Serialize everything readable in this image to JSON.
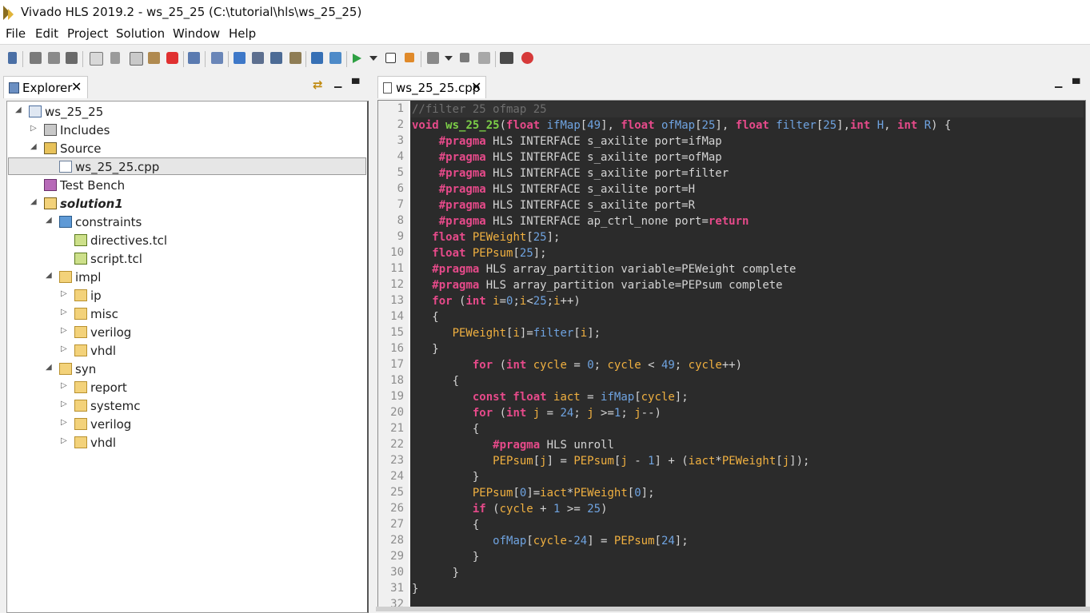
{
  "window": {
    "title": "Vivado HLS 2019.2 - ws_25_25 (C:\\tutorial\\hls\\ws_25_25)"
  },
  "menu": [
    "File",
    "Edit",
    "Project",
    "Solution",
    "Window",
    "Help"
  ],
  "explorer": {
    "tab_label": "Explorer",
    "tree": [
      {
        "label": "ws_25_25",
        "depth": 0,
        "twisty": "expanded",
        "icon": "project-icon"
      },
      {
        "label": "Includes",
        "depth": 1,
        "twisty": "collapsed",
        "icon": "includes-icon"
      },
      {
        "label": "Source",
        "depth": 1,
        "twisty": "expanded",
        "icon": "source-folder-icon"
      },
      {
        "label": "ws_25_25.cpp",
        "depth": 2,
        "twisty": "none",
        "icon": "cpp-file-icon",
        "selected": true
      },
      {
        "label": "Test Bench",
        "depth": 1,
        "twisty": "none",
        "icon": "testbench-icon"
      },
      {
        "label": "solution1",
        "depth": 1,
        "twisty": "expanded",
        "icon": "solution-folder-icon",
        "bold": true
      },
      {
        "label": "constraints",
        "depth": 2,
        "twisty": "expanded",
        "icon": "constraints-icon"
      },
      {
        "label": "directives.tcl",
        "depth": 3,
        "twisty": "none",
        "icon": "tcl-file-icon"
      },
      {
        "label": "script.tcl",
        "depth": 3,
        "twisty": "none",
        "icon": "tcl-file-icon"
      },
      {
        "label": "impl",
        "depth": 2,
        "twisty": "expanded",
        "icon": "folder-icon"
      },
      {
        "label": "ip",
        "depth": 3,
        "twisty": "collapsed",
        "icon": "folder-icon"
      },
      {
        "label": "misc",
        "depth": 3,
        "twisty": "collapsed",
        "icon": "folder-icon"
      },
      {
        "label": "verilog",
        "depth": 3,
        "twisty": "collapsed",
        "icon": "folder-icon"
      },
      {
        "label": "vhdl",
        "depth": 3,
        "twisty": "collapsed",
        "icon": "folder-icon"
      },
      {
        "label": "syn",
        "depth": 2,
        "twisty": "expanded",
        "icon": "folder-icon"
      },
      {
        "label": "report",
        "depth": 3,
        "twisty": "collapsed",
        "icon": "folder-icon"
      },
      {
        "label": "systemc",
        "depth": 3,
        "twisty": "collapsed",
        "icon": "folder-icon"
      },
      {
        "label": "verilog",
        "depth": 3,
        "twisty": "collapsed",
        "icon": "folder-icon"
      },
      {
        "label": "vhdl",
        "depth": 3,
        "twisty": "collapsed",
        "icon": "folder-icon"
      }
    ]
  },
  "editor": {
    "tab_label": "ws_25_25.cpp",
    "lines": [
      [
        [
          "cm",
          "//filter 25 ofmap 25"
        ]
      ],
      [
        [
          "kw",
          "void "
        ],
        [
          "fn",
          "ws_25_25"
        ],
        [
          "tx",
          "("
        ],
        [
          "kw",
          "float "
        ],
        [
          "par",
          "ifMap"
        ],
        [
          "tx",
          "["
        ],
        [
          "num",
          "49"
        ],
        [
          "tx",
          "], "
        ],
        [
          "kw",
          "float "
        ],
        [
          "par",
          "ofMap"
        ],
        [
          "tx",
          "["
        ],
        [
          "num",
          "25"
        ],
        [
          "tx",
          "], "
        ],
        [
          "kw",
          "float "
        ],
        [
          "par",
          "filter"
        ],
        [
          "tx",
          "["
        ],
        [
          "num",
          "25"
        ],
        [
          "tx",
          "],"
        ],
        [
          "kw",
          "int "
        ],
        [
          "par",
          "H"
        ],
        [
          "tx",
          ", "
        ],
        [
          "kw",
          "int "
        ],
        [
          "par",
          "R"
        ],
        [
          "tx",
          ") {"
        ]
      ],
      [
        [
          "tx",
          "    "
        ],
        [
          "pr",
          "#pragma"
        ],
        [
          "tx",
          " HLS INTERFACE s_axilite port=ifMap"
        ]
      ],
      [
        [
          "tx",
          "    "
        ],
        [
          "pr",
          "#pragma"
        ],
        [
          "tx",
          " HLS INTERFACE s_axilite port=ofMap"
        ]
      ],
      [
        [
          "tx",
          "    "
        ],
        [
          "pr",
          "#pragma"
        ],
        [
          "tx",
          " HLS INTERFACE s_axilite port=filter"
        ]
      ],
      [
        [
          "tx",
          "    "
        ],
        [
          "pr",
          "#pragma"
        ],
        [
          "tx",
          " HLS INTERFACE s_axilite port=H"
        ]
      ],
      [
        [
          "tx",
          "    "
        ],
        [
          "pr",
          "#pragma"
        ],
        [
          "tx",
          " HLS INTERFACE s_axilite port=R"
        ]
      ],
      [
        [
          "tx",
          "    "
        ],
        [
          "pr",
          "#pragma"
        ],
        [
          "tx",
          " HLS INTERFACE ap_ctrl_none port="
        ],
        [
          "kw",
          "return"
        ]
      ],
      [
        [
          "tx",
          "   "
        ],
        [
          "kw",
          "float "
        ],
        [
          "var",
          "PEWeight"
        ],
        [
          "tx",
          "["
        ],
        [
          "num",
          "25"
        ],
        [
          "tx",
          "];"
        ]
      ],
      [
        [
          "tx",
          "   "
        ],
        [
          "kw",
          "float "
        ],
        [
          "var",
          "PEPsum"
        ],
        [
          "tx",
          "["
        ],
        [
          "num",
          "25"
        ],
        [
          "tx",
          "];"
        ]
      ],
      [
        [
          "tx",
          "   "
        ],
        [
          "pr",
          "#pragma"
        ],
        [
          "tx",
          " HLS array_partition variable=PEWeight complete"
        ]
      ],
      [
        [
          "tx",
          "   "
        ],
        [
          "pr",
          "#pragma"
        ],
        [
          "tx",
          " HLS array_partition variable=PEPsum complete"
        ]
      ],
      [
        [
          "tx",
          "   "
        ],
        [
          "kw",
          "for "
        ],
        [
          "tx",
          "("
        ],
        [
          "kw",
          "int "
        ],
        [
          "var",
          "i"
        ],
        [
          "tx",
          "="
        ],
        [
          "num",
          "0"
        ],
        [
          "tx",
          ";"
        ],
        [
          "var",
          "i"
        ],
        [
          "tx",
          "<"
        ],
        [
          "num",
          "25"
        ],
        [
          "tx",
          ";"
        ],
        [
          "var",
          "i"
        ],
        [
          "tx",
          "++)"
        ]
      ],
      [
        [
          "tx",
          "   {"
        ]
      ],
      [
        [
          "tx",
          "      "
        ],
        [
          "var",
          "PEWeight"
        ],
        [
          "tx",
          "["
        ],
        [
          "var",
          "i"
        ],
        [
          "tx",
          "]="
        ],
        [
          "par",
          "filter"
        ],
        [
          "tx",
          "["
        ],
        [
          "var",
          "i"
        ],
        [
          "tx",
          "];"
        ]
      ],
      [
        [
          "tx",
          "   }"
        ]
      ],
      [
        [
          "tx",
          "         "
        ],
        [
          "kw",
          "for "
        ],
        [
          "tx",
          "("
        ],
        [
          "kw",
          "int "
        ],
        [
          "var",
          "cycle"
        ],
        [
          "tx",
          " = "
        ],
        [
          "num",
          "0"
        ],
        [
          "tx",
          "; "
        ],
        [
          "var",
          "cycle"
        ],
        [
          "tx",
          " < "
        ],
        [
          "num",
          "49"
        ],
        [
          "tx",
          "; "
        ],
        [
          "var",
          "cycle"
        ],
        [
          "tx",
          "++)"
        ]
      ],
      [
        [
          "tx",
          "      {"
        ]
      ],
      [
        [
          "tx",
          "         "
        ],
        [
          "kw",
          "const float "
        ],
        [
          "var",
          "iact"
        ],
        [
          "tx",
          " = "
        ],
        [
          "par",
          "ifMap"
        ],
        [
          "tx",
          "["
        ],
        [
          "var",
          "cycle"
        ],
        [
          "tx",
          "];"
        ]
      ],
      [
        [
          "tx",
          "         "
        ],
        [
          "kw",
          "for "
        ],
        [
          "tx",
          "("
        ],
        [
          "kw",
          "int "
        ],
        [
          "var",
          "j"
        ],
        [
          "tx",
          " = "
        ],
        [
          "num",
          "24"
        ],
        [
          "tx",
          "; "
        ],
        [
          "var",
          "j"
        ],
        [
          "tx",
          " >="
        ],
        [
          "num",
          "1"
        ],
        [
          "tx",
          "; "
        ],
        [
          "var",
          "j"
        ],
        [
          "tx",
          "--)"
        ]
      ],
      [
        [
          "tx",
          "         {"
        ]
      ],
      [
        [
          "tx",
          "            "
        ],
        [
          "pr",
          "#pragma"
        ],
        [
          "tx",
          " HLS unroll"
        ]
      ],
      [
        [
          "tx",
          "            "
        ],
        [
          "var",
          "PEPsum"
        ],
        [
          "tx",
          "["
        ],
        [
          "var",
          "j"
        ],
        [
          "tx",
          "] = "
        ],
        [
          "var",
          "PEPsum"
        ],
        [
          "tx",
          "["
        ],
        [
          "var",
          "j"
        ],
        [
          "tx",
          " - "
        ],
        [
          "num",
          "1"
        ],
        [
          "tx",
          "] + ("
        ],
        [
          "var",
          "iact"
        ],
        [
          "tx",
          "*"
        ],
        [
          "var",
          "PEWeight"
        ],
        [
          "tx",
          "["
        ],
        [
          "var",
          "j"
        ],
        [
          "tx",
          "]);"
        ]
      ],
      [
        [
          "tx",
          "         }"
        ]
      ],
      [
        [
          "tx",
          "         "
        ],
        [
          "var",
          "PEPsum"
        ],
        [
          "tx",
          "["
        ],
        [
          "num",
          "0"
        ],
        [
          "tx",
          "]="
        ],
        [
          "var",
          "iact"
        ],
        [
          "tx",
          "*"
        ],
        [
          "var",
          "PEWeight"
        ],
        [
          "tx",
          "["
        ],
        [
          "num",
          "0"
        ],
        [
          "tx",
          "];"
        ]
      ],
      [
        [
          "tx",
          "         "
        ],
        [
          "kw",
          "if "
        ],
        [
          "tx",
          "("
        ],
        [
          "var",
          "cycle"
        ],
        [
          "tx",
          " + "
        ],
        [
          "num",
          "1"
        ],
        [
          "tx",
          " >= "
        ],
        [
          "num",
          "25"
        ],
        [
          "tx",
          ")"
        ]
      ],
      [
        [
          "tx",
          "         {"
        ]
      ],
      [
        [
          "tx",
          "            "
        ],
        [
          "par",
          "ofMap"
        ],
        [
          "tx",
          "["
        ],
        [
          "var",
          "cycle"
        ],
        [
          "tx",
          "-"
        ],
        [
          "num",
          "24"
        ],
        [
          "tx",
          "] = "
        ],
        [
          "var",
          "PEPsum"
        ],
        [
          "tx",
          "["
        ],
        [
          "num",
          "24"
        ],
        [
          "tx",
          "];"
        ]
      ],
      [
        [
          "tx",
          "         }"
        ]
      ],
      [
        [
          "tx",
          "      }"
        ]
      ],
      [
        [
          "tx",
          "}"
        ]
      ],
      [
        [
          "tx",
          ""
        ]
      ]
    ]
  }
}
